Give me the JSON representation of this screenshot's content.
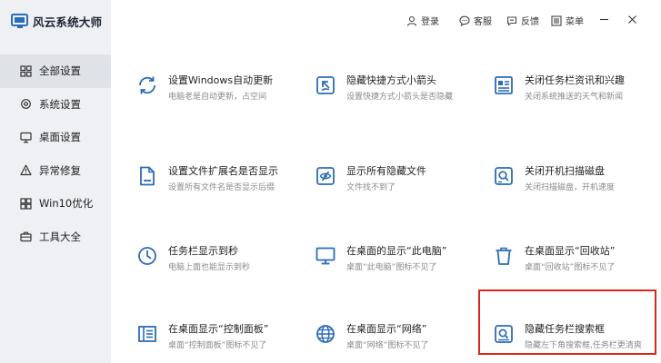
{
  "app": {
    "title": "风云系统大师"
  },
  "topbar": {
    "login": "登录",
    "service": "客服",
    "feedback": "反馈",
    "menu": "菜单"
  },
  "sidebar": {
    "items": [
      {
        "label": "全部设置",
        "icon": "grid-icon",
        "active": true
      },
      {
        "label": "系统设置",
        "icon": "settings-icon",
        "active": false
      },
      {
        "label": "桌面设置",
        "icon": "monitor-icon",
        "active": false
      },
      {
        "label": "异常修复",
        "icon": "warning-icon",
        "active": false
      },
      {
        "label": "Win10优化",
        "icon": "windows-icon",
        "active": false
      },
      {
        "label": "工具大全",
        "icon": "toolbox-icon",
        "active": false
      }
    ]
  },
  "cards": [
    {
      "title": "设置Windows自动更新",
      "desc": "电脑老是自动更新，占空间",
      "icon": "refresh-icon"
    },
    {
      "title": "隐藏快捷方式小箭头",
      "desc": "设置快捷方式小箭头是否隐藏",
      "icon": "shortcut-arrow-icon"
    },
    {
      "title": "关闭任务栏资讯和兴趣",
      "desc": "关闭系统推送的天气和新闻",
      "icon": "news-icon"
    },
    {
      "title": "设置文件扩展名是否显示",
      "desc": "设置所有文件名是否显示后缀",
      "icon": "file-icon"
    },
    {
      "title": "显示所有隐藏文件",
      "desc": "文件找不到了",
      "icon": "hidden-eye-icon"
    },
    {
      "title": "关闭开机扫描磁盘",
      "desc": "关闭扫描磁盘，开机速度",
      "icon": "disk-scan-icon"
    },
    {
      "title": "任务栏显示到秒",
      "desc": "电脑上面也能显示到秒",
      "icon": "clock-icon"
    },
    {
      "title": "在桌面的显示“此电脑”",
      "desc": "桌面“此电脑”图标不见了",
      "icon": "computer-icon"
    },
    {
      "title": "在桌面显示“回收站”",
      "desc": "桌面“回收站”图标不见了",
      "icon": "recycle-bin-icon"
    },
    {
      "title": "在桌面显示“控制面板”",
      "desc": "桌面“控制面板”图标不见了",
      "icon": "control-panel-icon"
    },
    {
      "title": "在桌面显示“网络”",
      "desc": "桌面“网络”图标不见了",
      "icon": "network-icon"
    },
    {
      "title": "隐藏任务栏搜索框",
      "desc": "隐藏左下角搜索框,任务栏更清爽",
      "icon": "search-box-icon"
    }
  ],
  "colors": {
    "accent": "#2b6cb6",
    "highlight": "#d9261c",
    "sidebar_bg": "#eef0f3"
  }
}
